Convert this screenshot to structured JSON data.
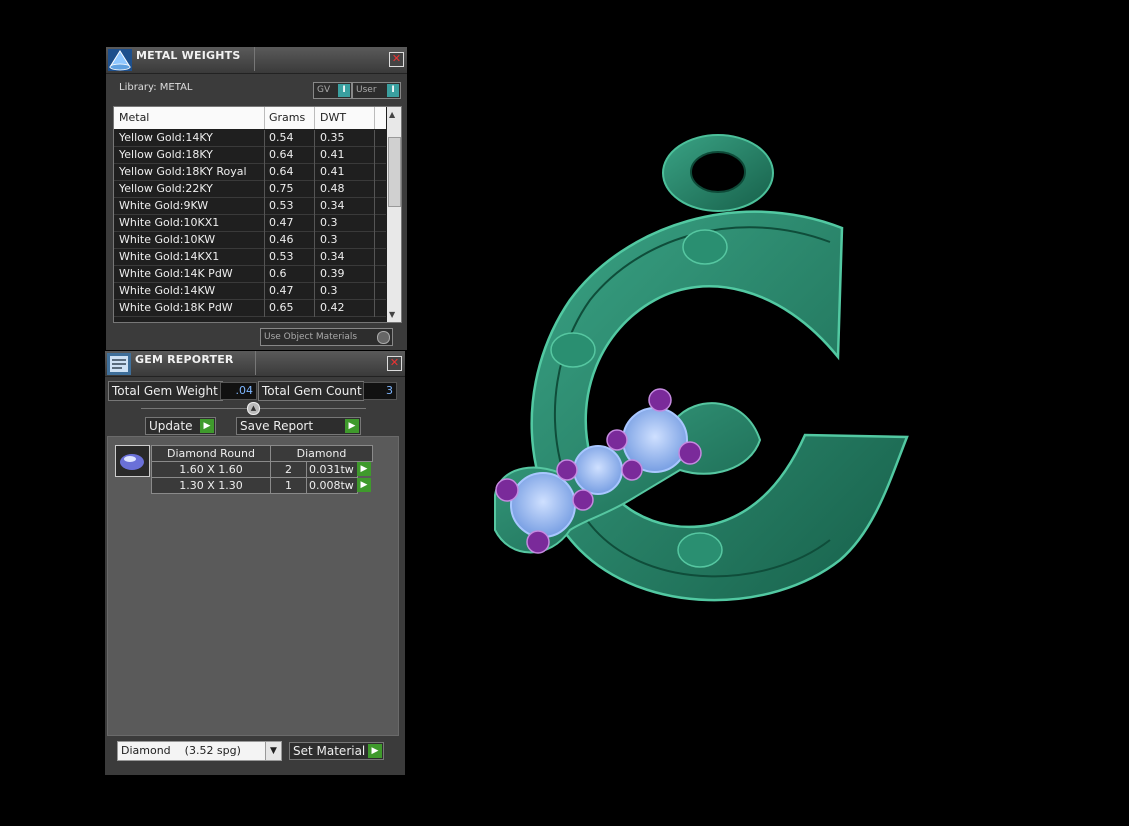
{
  "metal_weights": {
    "title": "METAL WEIGHTS",
    "close": "✕",
    "library_label": "Library: METAL",
    "toggles": [
      {
        "label": "GV",
        "knob": "I"
      },
      {
        "label": "User",
        "knob": "I"
      }
    ],
    "columns": [
      "Metal",
      "Grams",
      "DWT"
    ],
    "rows": [
      {
        "metal": "Yellow Gold:14KY",
        "grams": "0.54",
        "dwt": "0.35"
      },
      {
        "metal": "Yellow Gold:18KY",
        "grams": "0.64",
        "dwt": "0.41"
      },
      {
        "metal": "Yellow Gold:18KY Royal",
        "grams": "0.64",
        "dwt": "0.41"
      },
      {
        "metal": "Yellow Gold:22KY",
        "grams": "0.75",
        "dwt": "0.48"
      },
      {
        "metal": "White Gold:9KW",
        "grams": "0.53",
        "dwt": "0.34"
      },
      {
        "metal": "White Gold:10KX1",
        "grams": "0.47",
        "dwt": "0.3"
      },
      {
        "metal": "White Gold:10KW",
        "grams": "0.46",
        "dwt": "0.3"
      },
      {
        "metal": "White Gold:14KX1",
        "grams": "0.53",
        "dwt": "0.34"
      },
      {
        "metal": "White Gold:14K PdW",
        "grams": "0.6",
        "dwt": "0.39"
      },
      {
        "metal": "White Gold:14KW",
        "grams": "0.47",
        "dwt": "0.3"
      },
      {
        "metal": "White Gold:18K PdW",
        "grams": "0.65",
        "dwt": "0.42"
      }
    ],
    "use_object_materials": "Use Object Materials"
  },
  "gem_reporter": {
    "title": "GEM REPORTER",
    "close": "✕",
    "total_gem_weight_label": "Total Gem Weight",
    "total_gem_weight_value": ".04",
    "total_gem_count_label": "Total Gem Count",
    "total_gem_count_value": "3",
    "update_label": "Update",
    "save_report_label": "Save Report",
    "report": {
      "shape": "Diamond Round",
      "material": "Diamond",
      "rows": [
        {
          "size": "1.60 X 1.60",
          "count": "2",
          "weight": "0.031tw"
        },
        {
          "size": "1.30 X 1.30",
          "count": "1",
          "weight": "0.008tw"
        }
      ]
    },
    "material_select_value": "Diamond    (3.52 spg)",
    "set_material_label": "Set Material"
  },
  "colors": {
    "model_green": "#1f7a5e",
    "gem_blue": "#8fb6f0",
    "prong_purple": "#7a2a9a",
    "go_green": "#3f9a2c"
  }
}
